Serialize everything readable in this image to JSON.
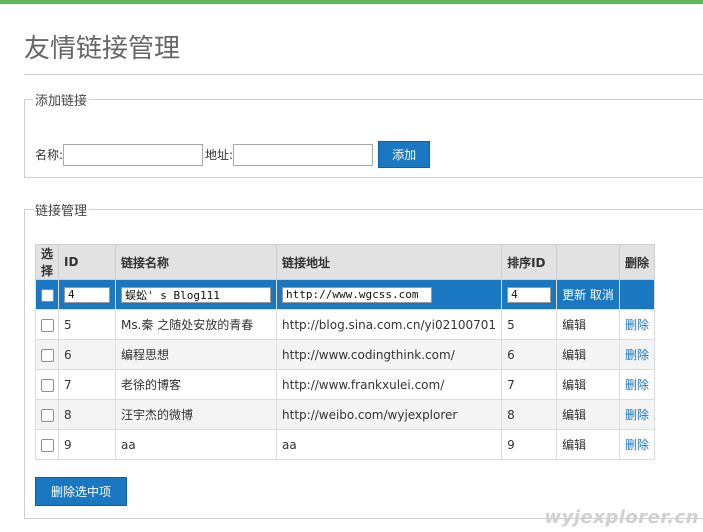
{
  "page": {
    "title": "友情链接管理"
  },
  "add_section": {
    "legend": "添加链接",
    "name_label": "名称:",
    "name_value": "",
    "url_label": "地址:",
    "url_value": "",
    "add_button": "添加"
  },
  "manage_section": {
    "legend": "链接管理",
    "headers": [
      "选择",
      "ID",
      "链接名称",
      "链接地址",
      "排序ID",
      "",
      "删除"
    ],
    "editing_row": {
      "id": "4",
      "name": "蜈蚣' s Blog111",
      "url": "http://www.wgcss.com",
      "order": "4",
      "update": "更新",
      "cancel": "取消"
    },
    "rows": [
      {
        "id": "5",
        "name": "Ms.秦 之随处安放的青春",
        "url": "http://blog.sina.com.cn/yi02100701",
        "order": "5",
        "edit": "编辑",
        "delete": "删除"
      },
      {
        "id": "6",
        "name": "编程思想",
        "url": "http://www.codingthink.com/",
        "order": "6",
        "edit": "编辑",
        "delete": "删除"
      },
      {
        "id": "7",
        "name": "老徐的博客",
        "url": "http://www.frankxulei.com/",
        "order": "7",
        "edit": "编辑",
        "delete": "删除"
      },
      {
        "id": "8",
        "name": "汪宇杰的微博",
        "url": "http://weibo.com/wyjexplorer",
        "order": "8",
        "edit": "编辑",
        "delete": "删除"
      },
      {
        "id": "9",
        "name": "aa",
        "url": "aa",
        "order": "9",
        "edit": "编辑",
        "delete": "删除"
      }
    ],
    "delete_selected_button": "删除选中项"
  },
  "watermark": "wyjexplorer.cn",
  "colors": {
    "accent": "#1a78c2",
    "topbar": "#5cb85c"
  }
}
